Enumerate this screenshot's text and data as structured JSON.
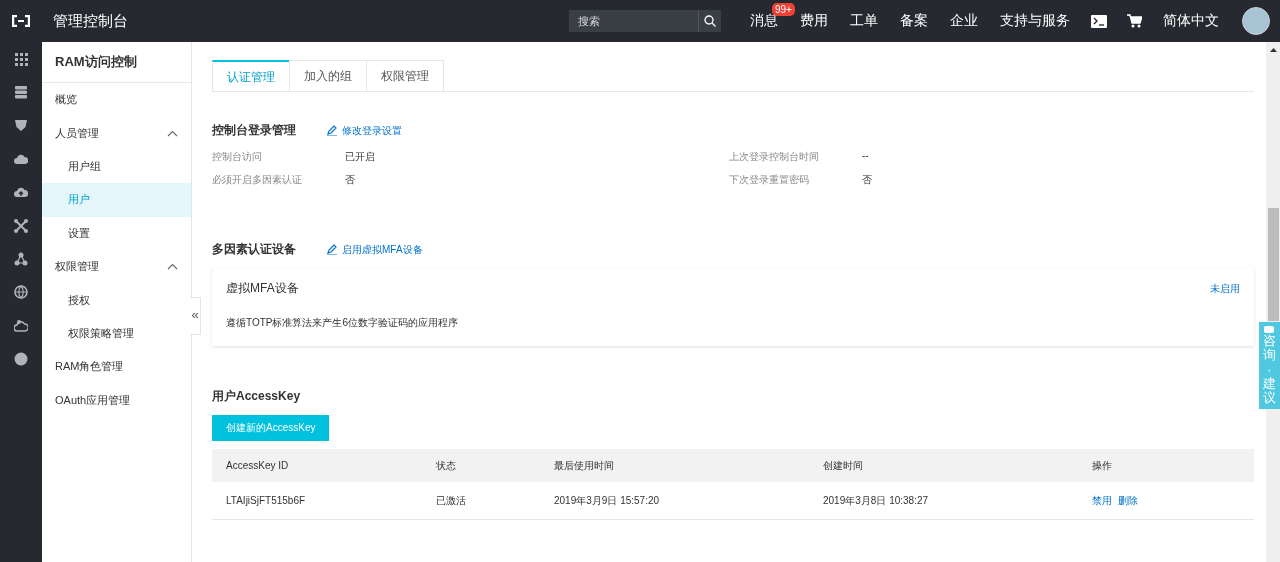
{
  "top_bar": {
    "title": "管理控制台",
    "search": {
      "placeholder": "搜索"
    },
    "nav": [
      {
        "label": "消息",
        "badge": "99+"
      },
      {
        "label": "费用"
      },
      {
        "label": "工单"
      },
      {
        "label": "备案"
      },
      {
        "label": "企业"
      },
      {
        "label": "支持与服务"
      }
    ],
    "language": "简体中文"
  },
  "sidebar": {
    "title": "RAM访问控制",
    "items": [
      {
        "label": "概览",
        "selected": false
      },
      {
        "label": "人员管理",
        "selected": false,
        "expanded": true,
        "children": [
          {
            "label": "用户组",
            "selected": false
          },
          {
            "label": "用户",
            "selected": true
          },
          {
            "label": "设置",
            "selected": false
          }
        ]
      },
      {
        "label": "权限管理",
        "selected": false,
        "expanded": true,
        "children": [
          {
            "label": "授权",
            "selected": false
          },
          {
            "label": "权限策略管理",
            "selected": false
          }
        ]
      },
      {
        "label": "RAM角色管理",
        "selected": false
      },
      {
        "label": "OAuth应用管理",
        "selected": false
      }
    ]
  },
  "collapse_handle": "«",
  "tabs": [
    {
      "label": "认证管理",
      "selected": true
    },
    {
      "label": "加入的组",
      "selected": false
    },
    {
      "label": "权限管理",
      "selected": false
    }
  ],
  "console_login": {
    "title": "控制台登录管理",
    "action": "修改登录设置",
    "fields": [
      {
        "label": "控制台访问",
        "value": "已开启"
      },
      {
        "label": "上次登录控制台时间",
        "value": "--"
      },
      {
        "label": "必须开启多因素认证",
        "value": "否"
      },
      {
        "label": "下次登录重置密码",
        "value": "否"
      }
    ]
  },
  "mfa": {
    "title": "多因素认证设备",
    "action": "启用虚拟MFA设备",
    "device": {
      "name": "虚拟MFA设备",
      "status": "未启用",
      "description": "遵循TOTP标准算法来产生6位数字验证码的应用程序"
    }
  },
  "access_key": {
    "title": "用户AccessKey",
    "create_button": "创建新的AccessKey",
    "columns": [
      "AccessKey ID",
      "状态",
      "最后使用时间",
      "创建时间",
      "操作"
    ],
    "rows": [
      {
        "cells": [
          "LTAIjiSjFT515b6F",
          "已激活",
          "2019年3月9日 15:57:20",
          "2019年3月8日 10:38:27"
        ],
        "actions": [
          "禁用",
          "删除"
        ]
      }
    ]
  },
  "feedback_tab": "咨询·建议"
}
